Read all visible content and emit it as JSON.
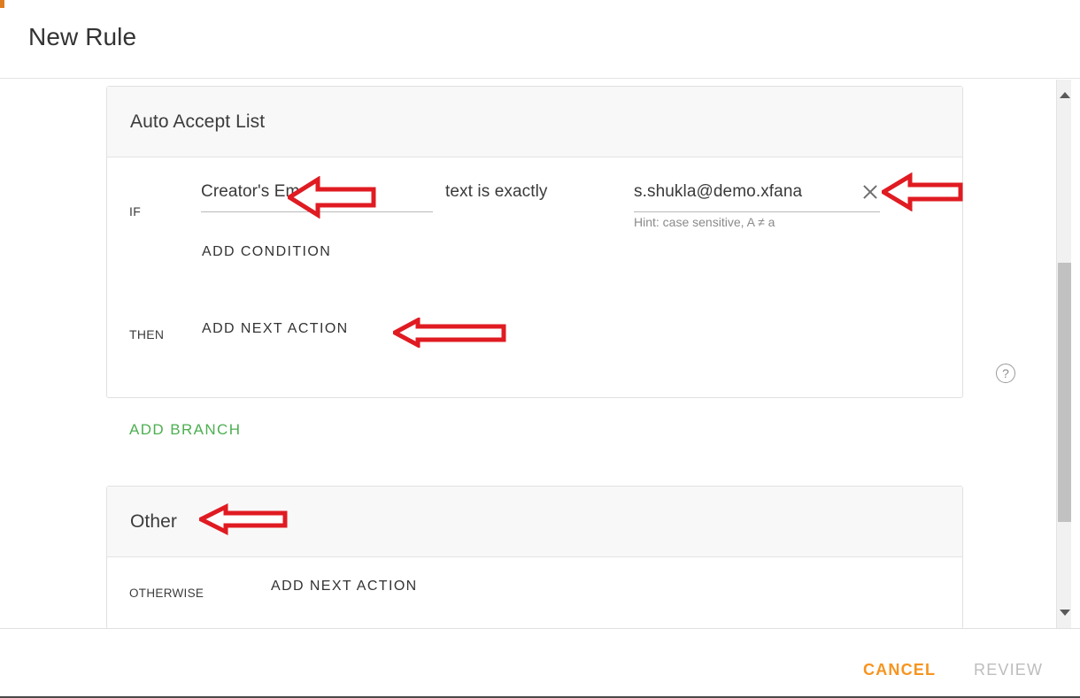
{
  "dialog": {
    "title": "New Rule"
  },
  "branches": [
    {
      "name": "Auto Accept List",
      "if_label": "IF",
      "condition": {
        "attribute": "Creator's Email",
        "operator": "text is exactly",
        "value": "s.shukla@demo.xfana",
        "hint": "Hint: case sensitive, A ≠ a",
        "clear_icon": "close-icon"
      },
      "add_condition_label": "ADD CONDITION",
      "then_label": "THEN",
      "add_next_action_label": "ADD NEXT ACTION"
    },
    {
      "name": "Other",
      "otherwise_label": "OTHERWISE",
      "add_next_action_label": "ADD NEXT ACTION"
    }
  ],
  "add_branch_label": "ADD BRANCH",
  "help_icon": "?",
  "footer": {
    "cancel_label": "CANCEL",
    "review_label": "REVIEW"
  },
  "colors": {
    "add_branch_green": "#4caf50",
    "cancel_orange": "#f7941e",
    "review_disabled": "#bdbdbd",
    "annotation_red": "#e01b22",
    "card_header_bg": "#f8f8f8",
    "border": "#e0e0e0"
  }
}
